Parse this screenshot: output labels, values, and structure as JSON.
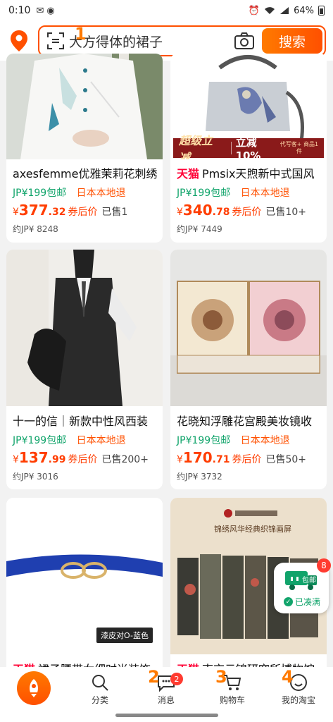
{
  "status_bar": {
    "time": "0:10",
    "battery": "64%"
  },
  "search": {
    "query": "大方得体的裙子",
    "button_label": "搜索",
    "marker": "1"
  },
  "products": [
    {
      "tmall": "",
      "title": "axesfemme优雅茉莉花刺绣",
      "shipping": "JP¥199包邮",
      "returns": "日本本地退",
      "price_currency": "¥",
      "price_int": "377",
      "price_dec": ".32",
      "after_label": "券后价",
      "sold": "已售1",
      "approx": "约JP¥ 8248"
    },
    {
      "tmall": "天猫",
      "title": "Pmsix天煦新中式国风",
      "shipping": "JP¥199包邮",
      "returns": "日本本地退",
      "price_currency": "¥",
      "price_int": "340",
      "price_dec": ".78",
      "after_label": "券后价",
      "sold": "已售10+",
      "approx": "约JP¥ 7449",
      "badge": {
        "label": "超级立减",
        "discount": "立减10%",
        "note": "代写客+ 商品1件"
      }
    },
    {
      "tmall": "",
      "title": "十一的信｜新款中性风西装",
      "shipping": "JP¥199包邮",
      "returns": "日本本地退",
      "price_currency": "¥",
      "price_int": "137",
      "price_dec": ".99",
      "after_label": "券后价",
      "sold": "已售200+",
      "approx": "约JP¥ 3016"
    },
    {
      "tmall": "",
      "title": "花晓知浮雕花宫殿美妆镜收",
      "shipping": "JP¥199包邮",
      "returns": "日本本地退",
      "price_currency": "¥",
      "price_int": "170",
      "price_dec": ".71",
      "after_label": "券后价",
      "sold": "已售50+",
      "approx": "约JP¥ 3732"
    },
    {
      "tmall": "天猫",
      "title": "裙子腰带女细时尚装饰",
      "image_label": "漆皮对O-蓝色"
    },
    {
      "tmall": "天猫",
      "title": "南京云锦研究所博物馆",
      "image_caption": "锦绣风华经典织锦画屏"
    }
  ],
  "float_cart": {
    "count": "8",
    "pkg_label": "包邮",
    "status": "已凑满"
  },
  "bottom_nav": [
    {
      "label": "分类",
      "marker": ""
    },
    {
      "label": "消息",
      "marker": "2",
      "badge": "2"
    },
    {
      "label": "购物车",
      "marker": "3"
    },
    {
      "label": "我的淘宝",
      "marker": "4"
    }
  ]
}
